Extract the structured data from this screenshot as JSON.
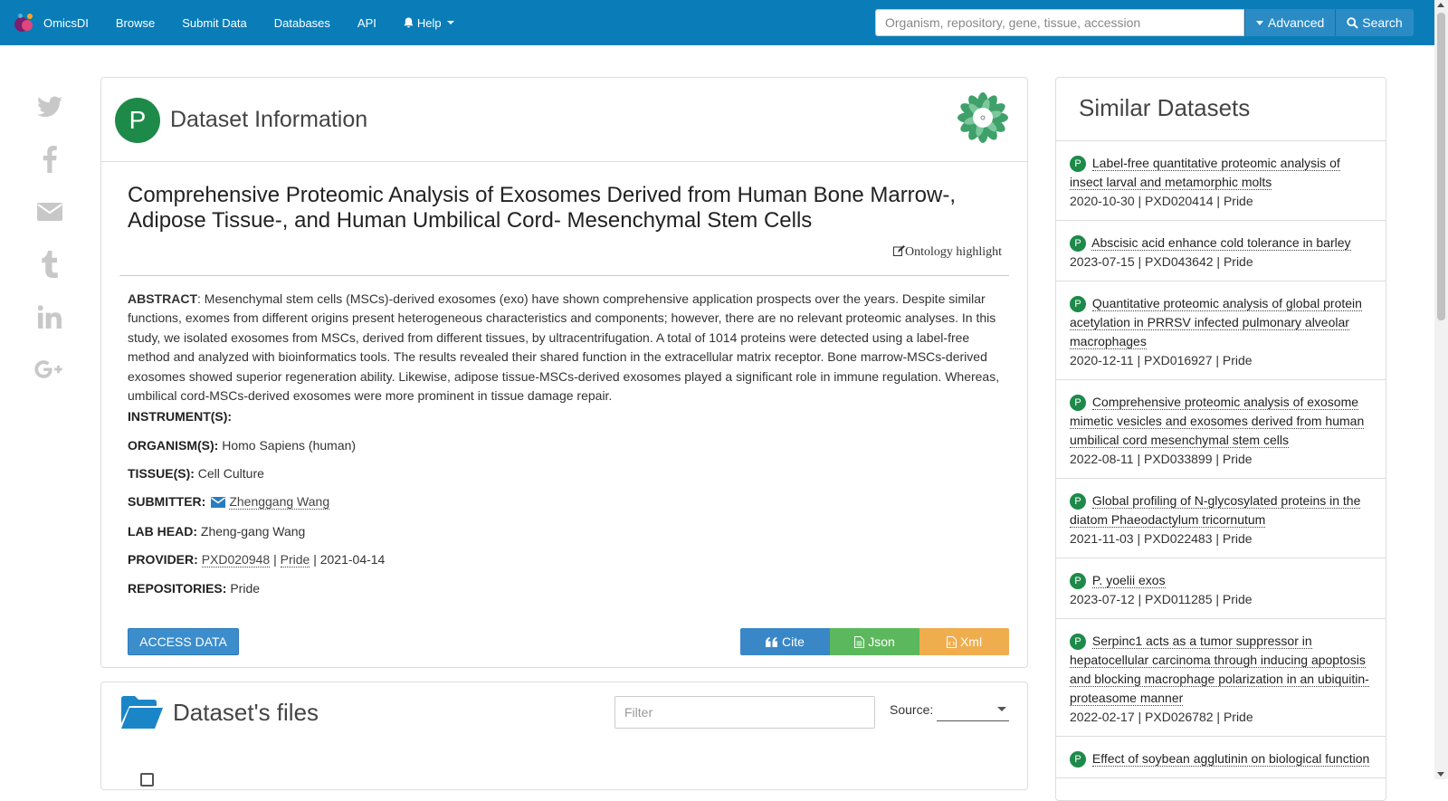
{
  "nav": {
    "brand": "OmicsDI",
    "items": [
      "Browse",
      "Submit Data",
      "Databases",
      "API"
    ],
    "help": "Help",
    "search_placeholder": "Organism, repository, gene, tissue, accession",
    "advanced": "Advanced",
    "search": "Search"
  },
  "social": [
    "twitter-icon",
    "facebook-icon",
    "email-icon",
    "tumblr-icon",
    "linkedin-icon",
    "google-plus-icon"
  ],
  "dataset": {
    "header_title": "Dataset Information",
    "repo_letter": "P",
    "title": "Comprehensive Proteomic Analysis of Exosomes Derived from Human Bone Marrow-, Adipose Tissue-, and Human Umbilical Cord- Mesenchymal Stem Cells",
    "ontology": "Ontology highlight",
    "abstract_label": "ABSTRACT",
    "abstract": ": Mesenchymal stem cells (MSCs)-derived exosomes (exo) have shown comprehensive application prospects over the years. Despite similar functions, exomes from different origins present heterogeneous characteristics and components; however, there are no relevant proteomic analyses. In this study, we isolated exosomes from MSCs, derived from different tissues, by ultracentrifugation. A total of 1014 proteins were detected using a label-free method and analyzed with bioinformatics tools. The results revealed their shared function in the extracellular matrix receptor. Bone marrow-MSCs-derived exosomes showed superior regeneration ability. Likewise, adipose tissue-MSCs-derived exosomes played a significant role in immune regulation. Whereas, umbilical cord-MSCs-derived exosomes were more prominent in tissue damage repair.",
    "instrument_label": "INSTRUMENT(S):",
    "organism_label": "ORGANISM(S):",
    "organism": "Homo Sapiens (human)",
    "tissue_label": "TISSUE(S):",
    "tissue": "Cell Culture",
    "submitter_label": "SUBMITTER:",
    "submitter": "Zhenggang Wang",
    "labhead_label": "LAB HEAD:",
    "labhead": "Zheng-gang Wang",
    "provider_label": "PROVIDER:",
    "provider_acc": "PXD020948",
    "provider_repo": "Pride",
    "provider_date": "2021-04-14",
    "repos_label": "REPOSITORIES:",
    "repos": "Pride",
    "access_btn": "ACCESS DATA",
    "cite_btn": "Cite",
    "json_btn": "Json",
    "xml_btn": "Xml",
    "sep": "|"
  },
  "files": {
    "title": "Dataset's files",
    "filter_placeholder": "Filter",
    "source_label": "Source:"
  },
  "similar": {
    "title": "Similar Datasets",
    "items": [
      {
        "title": "Label-free quantitative proteomic analysis of insect larval and metamorphic molts",
        "meta": "2020-10-30 | PXD020414 | Pride"
      },
      {
        "title": "Abscisic acid enhance cold tolerance in barley",
        "meta": "2023-07-15 | PXD043642 | Pride"
      },
      {
        "title": "Quantitative proteomic analysis of global protein acetylation in PRRSV infected pulmonary alveolar macrophages",
        "meta": "2020-12-11 | PXD016927 | Pride"
      },
      {
        "title": "Comprehensive proteomic analysis of exosome mimetic vesicles and exosomes derived from human umbilical cord mesenchymal stem cells",
        "meta": "2022-08-11 | PXD033899 | Pride"
      },
      {
        "title": "Global profiling of N-glycosylated proteins in the diatom Phaeodactylum tricornutum",
        "meta": "2021-11-03 | PXD022483 | Pride"
      },
      {
        "title": "P. yoelii exos",
        "meta": "2023-07-12 | PXD011285 | Pride"
      },
      {
        "title": "Serpinc1 acts as a tumor suppressor in hepatocellular carcinoma through inducing apoptosis and blocking macrophage polarization in an ubiquitin-proteasome manner",
        "meta": "2022-02-17 | PXD026782 | Pride"
      },
      {
        "title": "Effect of soybean agglutinin on biological function",
        "meta": ""
      }
    ]
  }
}
